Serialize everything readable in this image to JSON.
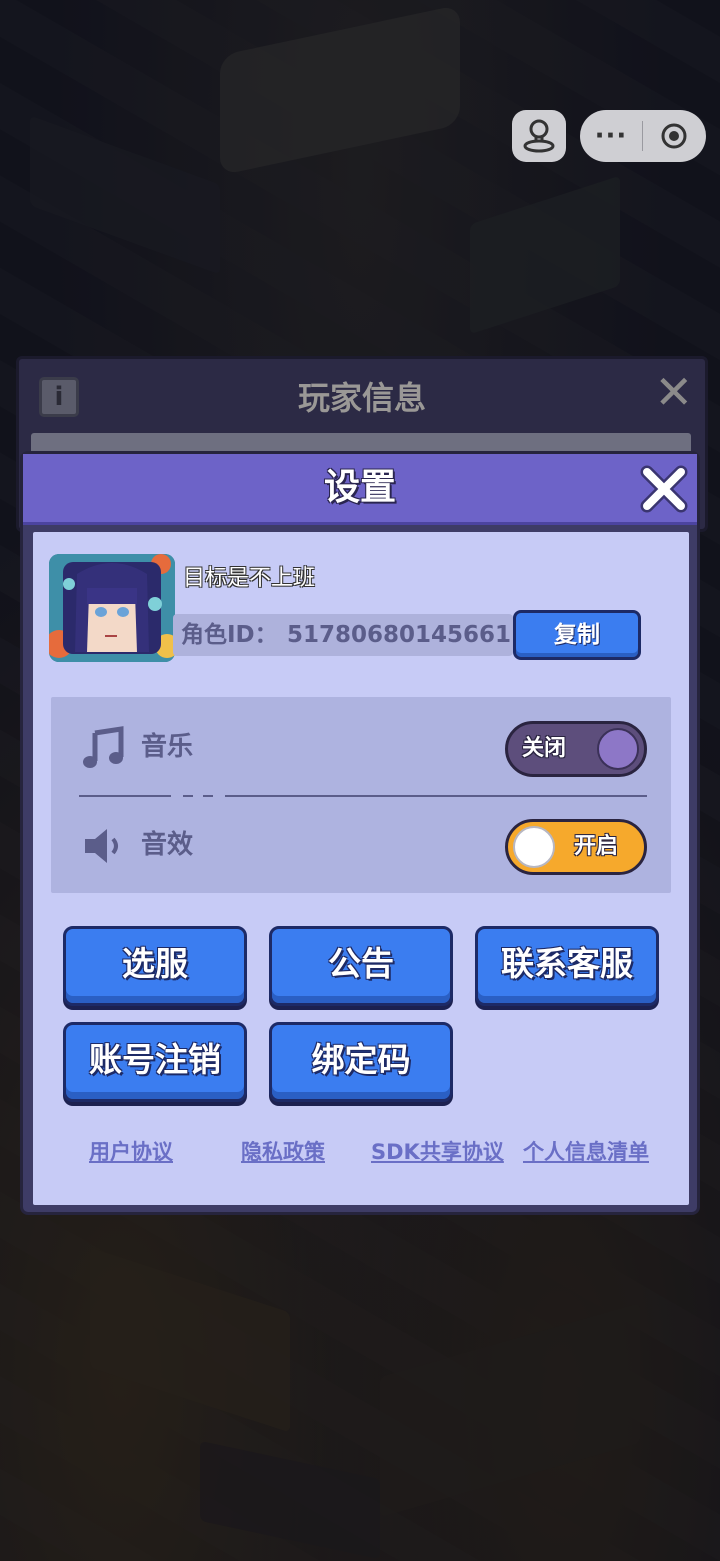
{
  "background_panel": {
    "title": "玩家信息",
    "info_icon_text": "i"
  },
  "settings": {
    "title": "设置",
    "profile": {
      "nickname": "目标是不上班",
      "id_label": "角色ID：",
      "id_value": "51780680145661",
      "copy_label": "复制"
    },
    "audio": {
      "music": {
        "label": "音乐",
        "toggle_text": "关闭",
        "state": "off"
      },
      "sfx": {
        "label": "音效",
        "toggle_text": "开启",
        "state": "on"
      }
    },
    "buttons": [
      {
        "label": "选服"
      },
      {
        "label": "公告"
      },
      {
        "label": "联系客服"
      },
      {
        "label": "账号注销"
      },
      {
        "label": "绑定码"
      }
    ],
    "links": [
      {
        "label": "用户协议"
      },
      {
        "label": "隐私政策"
      },
      {
        "label": "SDK共享协议"
      },
      {
        "label": "个人信息清单"
      }
    ]
  },
  "colors": {
    "header": "#6d63c8",
    "body": "#c7cbf6",
    "button": "#3b7df0",
    "toggle_on": "#f6a92c",
    "toggle_off": "#5d4e7c"
  }
}
